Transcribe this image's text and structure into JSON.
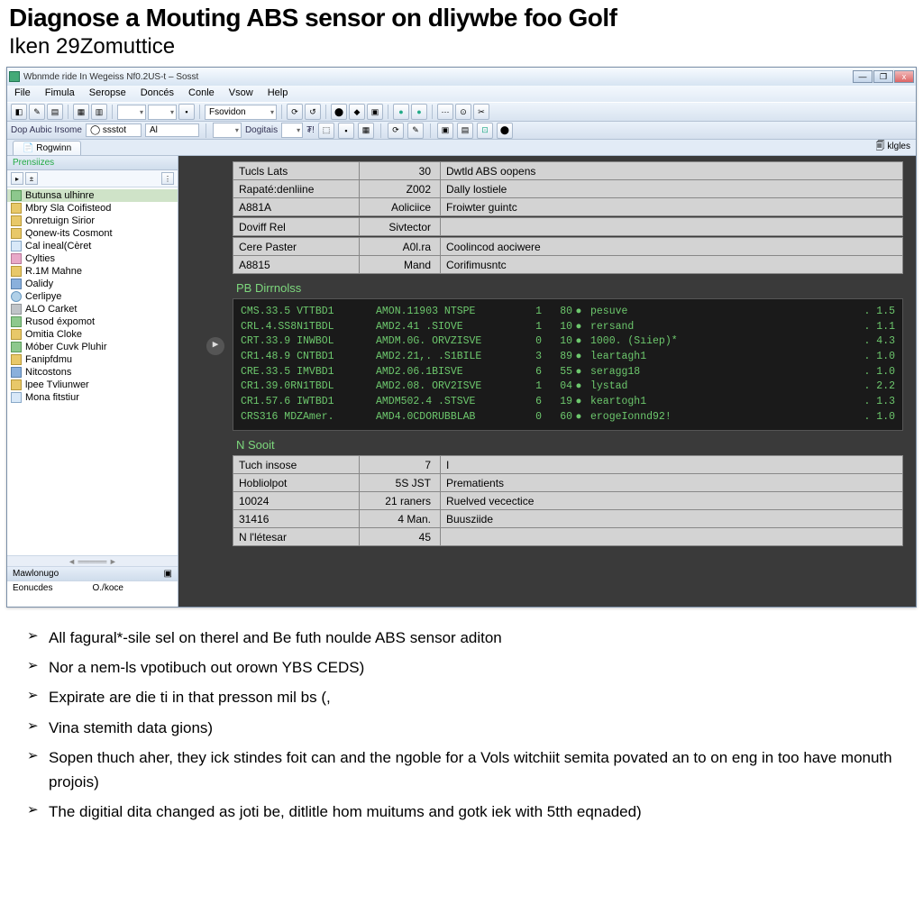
{
  "article": {
    "title": "Diagnose a Mouting ABS sensor on dliywbe foo Golf",
    "subtitle": "Iken 29Zomuttice"
  },
  "titlebar": "Wbnmde ride In Wegeiss Nf0.2US-t – Sosst",
  "minimize": "—",
  "maximize": "❐",
  "close": "x",
  "menu": [
    "File",
    "Fimula",
    "Seropse",
    "Doncés",
    "Conle",
    "Vsow",
    "Help"
  ],
  "toolbar1": {
    "combo1": "Fsovidon"
  },
  "subbar": {
    "l1": "Dop Aubic Irsome",
    "f1": "◯ ssstot",
    "l2": "Al",
    "l3": "Dogitais",
    "l4": "₮!"
  },
  "tab": "Rogwinn",
  "tab_right": "klgles",
  "sidebar": {
    "header": "Prensiizes",
    "items": [
      {
        "icon": "ic-green",
        "label": "Butunsa ulhinre",
        "sel": true
      },
      {
        "icon": "ic-folder",
        "label": "Mbry Sla Coifisteod"
      },
      {
        "icon": "ic-folder",
        "label": "Onretuign Sirior"
      },
      {
        "icon": "ic-folder",
        "label": "Qonew-its Cosmont"
      },
      {
        "icon": "ic-file",
        "label": "Cal ineal(Cèret"
      },
      {
        "icon": "ic-pink",
        "label": "Cylties"
      },
      {
        "icon": "ic-folder",
        "label": "R.1M Mahne"
      },
      {
        "icon": "ic-blue",
        "label": "Oalidy"
      },
      {
        "icon": "ic-gear",
        "label": "Cerlipye"
      },
      {
        "icon": "ic-gray",
        "label": "ALO Carket"
      },
      {
        "icon": "ic-green",
        "label": "Rusod éxpomot"
      },
      {
        "icon": "ic-folder",
        "label": "Omitia Cloke"
      },
      {
        "icon": "ic-green",
        "label": "Móber Cuvk Pluhir"
      },
      {
        "icon": "ic-folder",
        "label": "Fanipfdmu"
      },
      {
        "icon": "ic-blue",
        "label": "Nitcostons"
      },
      {
        "icon": "ic-folder",
        "label": "lpee Tvliunwer"
      },
      {
        "icon": "ic-file",
        "label": "Mona fitstiur"
      }
    ],
    "section1": "Mawlonugo",
    "section2_l": "Eonucdes",
    "section2_r": "O./koce"
  },
  "table1": [
    {
      "label": "Tucls Lats",
      "val": "30",
      "r2": "Dwtld ABS oopens"
    },
    {
      "label": "Rapaté:denliine",
      "val": "Z002",
      "r2": "Dally lostiele"
    },
    {
      "label": "A881A",
      "val": "Aoliciice",
      "r2": "Froiwter guintc"
    },
    {
      "label": "Doviff Rel",
      "val": "Sivtector",
      "r2": ""
    },
    {
      "label": "Cere Paster",
      "val": "A0l.ra",
      "r2": "Coolincod aociwere"
    },
    {
      "label": "A8815",
      "val": "Mand",
      "r2": "Corifimusntc"
    }
  ],
  "diag_title": "PB Dirrnolss",
  "terminal": [
    {
      "c1": "CMS.33.5 VTTBD1",
      "c2": "AMON.11903 NTSPE",
      "c3": "1",
      "c4": "80",
      "c6": "pesuve",
      "c7": ". 1.5"
    },
    {
      "c1": "CRL.4.SS8N1TBDL",
      "c2": "AMD2.41 .SIOVE",
      "c3": "1",
      "c4": "10",
      "c6": "rersand",
      "c7": ". 1.1"
    },
    {
      "c1": "CRT.33.9 INWBOL",
      "c2": "AMDM.0G. ORVZISVE",
      "c3": "0",
      "c4": "10",
      "c6": "1000. (Sıiep)*",
      "c7": ". 4.3"
    },
    {
      "c1": "CR1.48.9 CNTBD1",
      "c2": "AMD2.21,. .S1BILE",
      "c3": "3",
      "c4": "89",
      "c6": "leartagh1",
      "c7": ". 1.0"
    },
    {
      "c1": "CRE.33.5 IMVBD1",
      "c2": "AMD2.06.1BISVE",
      "c3": "6",
      "c4": "55",
      "c6": "seragg18",
      "c7": ". 1.0"
    },
    {
      "c1": "CR1.39.0RN1TBDL",
      "c2": "AMD2.08. ORV2ISVE",
      "c3": "1",
      "c4": "04",
      "c6": "lystad",
      "c7": ". 2.2"
    },
    {
      "c1": "CR1.57.6 IWTBD1",
      "c2": "AMDM502.4 .STSVE",
      "c3": "6",
      "c4": "19",
      "c6": "keartogh1",
      "c7": ". 1.3"
    },
    {
      "c1": "CRS316 MDZAmer.",
      "c2": "AMD4.0CDORUBBLAB",
      "c3": "0",
      "c4": "60",
      "c6": "erogeIonnd92!",
      "c7": ". 1.0"
    }
  ],
  "section2_title": "N Sooit",
  "table2": [
    {
      "label": "Tuch insose",
      "val": "7",
      "r2": "I"
    },
    {
      "label": "Hobliolpot",
      "val": "5S JST",
      "r2": "Prematients"
    },
    {
      "label": "10024",
      "val": "21 raners",
      "r2": "Ruelved vecectice"
    },
    {
      "label": "31416",
      "val": "4 Man.",
      "r2": "Buusziide"
    },
    {
      "label": "N l'létesar",
      "val": "45",
      "r2": ""
    }
  ],
  "bullets": [
    "All fagural*-sile sel on therel and Be futh noulde ABS sensor aditon",
    "Nor a nem-ls vpotibuch out orown YBS CEDS)",
    "Expirate are die ti in that presson mil bs (,",
    "Vina stemith data gions)",
    "Sopen thuch aher, they ick stindes foit can and the ngoble for a Vols witchiit semita povated an to on eng in too have monuth projois)",
    "The digitial dita changed as joti be, ditlitle hom muitums and gotk iek with 5tth eqnaded)"
  ]
}
